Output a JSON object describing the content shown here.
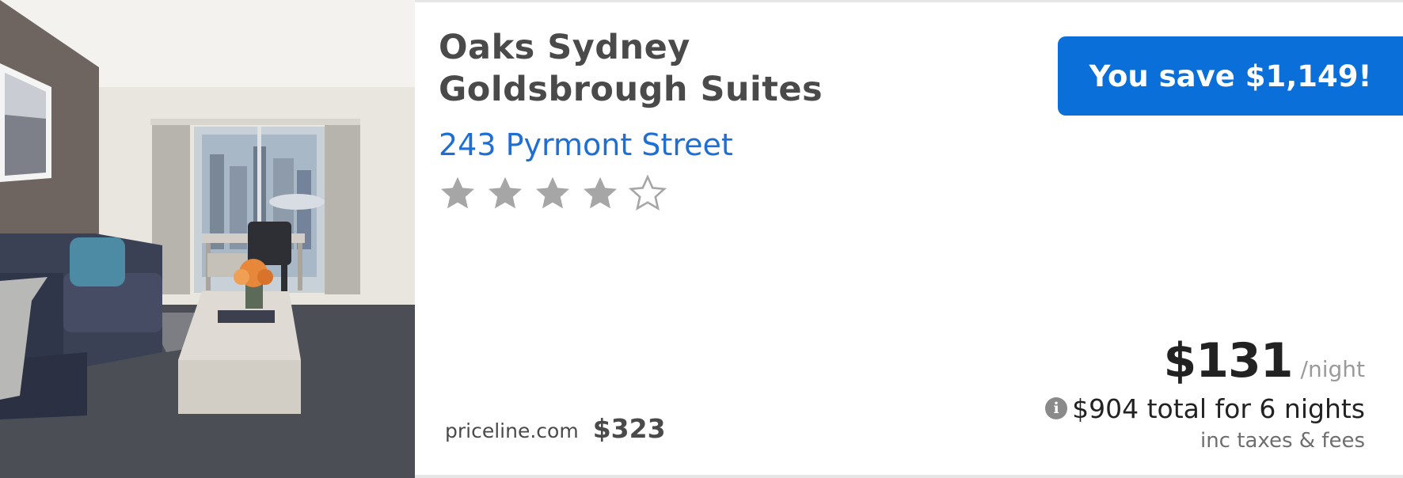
{
  "photo": {
    "alt_icon": "hotel-room-photo",
    "colors": {
      "wall": "#e6e3dc",
      "accent_wall": "#6f6560",
      "sofa": "#3a4155",
      "carpet": "#4c4e55",
      "table": "#d9d5cf"
    }
  },
  "hotel": {
    "name": "Oaks Sydney Goldsbrough Suites",
    "address": "243 Pyrmont Street",
    "rating": 4,
    "max_rating": 5
  },
  "badge": {
    "label": "You save $1,149!",
    "color": "#0a6fd8"
  },
  "competitor": {
    "site": "priceline.com",
    "price": "$323"
  },
  "pricing": {
    "price": "$131",
    "per": "/night",
    "info_icon": "info-icon",
    "total": "$904 total for 6 nights",
    "taxes": "inc taxes & fees"
  },
  "colors": {
    "text_dark": "#4a4a4a",
    "link_blue": "#1d6fd6",
    "star_gray": "#a6a6a6"
  }
}
